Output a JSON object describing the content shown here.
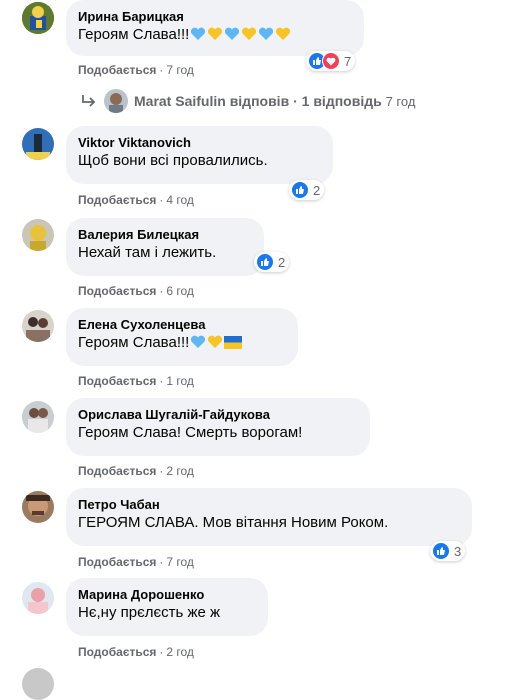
{
  "comments": [
    {
      "name": "Ирина Барицкая",
      "text": "Героям Слава!!!",
      "like_label": "Подобається",
      "time": "7 год",
      "reactions": "7"
    },
    {
      "name": "Viktor Viktanovich",
      "text": "Щоб вони всі провалились.",
      "like_label": "Подобається",
      "time": "4 год",
      "reactions": "2"
    },
    {
      "name": "Валерия Билецкая",
      "text": "Нехай там і лежить.",
      "like_label": "Подобається",
      "time": "6 год",
      "reactions": "2"
    },
    {
      "name": "Елена Сухоленцева",
      "text": "Героям Слава!!!",
      "like_label": "Подобається",
      "time": "1 год"
    },
    {
      "name": "Орислава Шугалій-Гайдукова",
      "text": "Героям Слава! Смерть ворогам!",
      "like_label": "Подобається",
      "time": "2 год"
    },
    {
      "name": "Петро Чабан",
      "text": "ГЕРОЯМ СЛАВА. Мов вітання Новим Роком.",
      "like_label": "Подобається",
      "time": "7 год",
      "reactions": "3"
    },
    {
      "name": "Марина Дорошенко",
      "text": "Нє,ну прєлєсть же ж",
      "like_label": "Подобається",
      "time": "2 год"
    }
  ],
  "reply_summary": {
    "author": "Marat Saifulin",
    "action": "відповів",
    "sep": "·",
    "count": "1 відповідь",
    "time": "7 год"
  },
  "colors": {
    "bubble": "#f0f2f5",
    "like_blue": "#1877f2",
    "love_red": "#f33e58",
    "meta_grey": "#65676b",
    "emoji_blue": "#5db7f5",
    "emoji_yellow": "#f7c325"
  },
  "icons": {
    "reply_arrow": "reply-arrow-icon",
    "like": "like-icon",
    "love": "love-icon",
    "heart": "heart-emoji-icon",
    "flag": "ukraine-flag-icon"
  }
}
